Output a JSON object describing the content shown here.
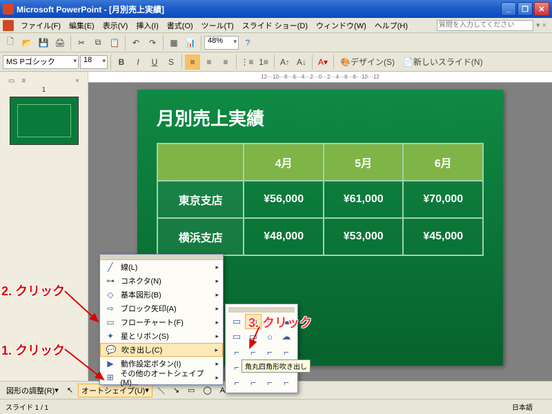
{
  "title": "Microsoft PowerPoint - [月別売上実績]",
  "window_buttons": {
    "min": "_",
    "max": "❐",
    "close": "✕"
  },
  "menu": [
    "ファイル(F)",
    "編集(E)",
    "表示(V)",
    "挿入(I)",
    "書式(O)",
    "ツール(T)",
    "スライド ショー(D)",
    "ウィンドウ(W)",
    "ヘルプ(H)"
  ],
  "question_box": "質問を入力してください",
  "font_name": "MS Pゴシック",
  "font_size": "18",
  "zoom": "48%",
  "design_btn": "デザイン(S)",
  "newslide_btn": "新しいスライド(N)",
  "ruler_text": "12···10···8···6···4···2···0···2···4···6···8···10···12",
  "slide": {
    "title": "月別売上実績",
    "headers": [
      "",
      "4月",
      "5月",
      "6月"
    ],
    "rows": [
      [
        "東京支店",
        "¥56,000",
        "¥61,000",
        "¥70,000"
      ],
      [
        "横浜支店",
        "¥48,000",
        "¥53,000",
        "¥45,000"
      ]
    ]
  },
  "autoshape_menu": [
    {
      "icon": "╱",
      "label": "線(L)"
    },
    {
      "icon": "⊶",
      "label": "コネクタ(N)"
    },
    {
      "icon": "◇",
      "label": "基本図形(B)"
    },
    {
      "icon": "⇨",
      "label": "ブロック矢印(A)"
    },
    {
      "icon": "▭",
      "label": "フローチャート(F)"
    },
    {
      "icon": "✦",
      "label": "星とリボン(S)"
    },
    {
      "icon": "💬",
      "label": "吹き出し(C)",
      "hi": true
    },
    {
      "icon": "▶",
      "label": "動作設定ボタン(I)"
    },
    {
      "icon": "⊞",
      "label": "その他のオートシェイプ(M)..."
    }
  ],
  "palette_icons": [
    [
      "▭",
      "▭",
      "○",
      "☁"
    ],
    [
      "▭",
      "▭",
      "○",
      "☁"
    ],
    [
      "⌐",
      "⌐",
      "⌐",
      "⌐"
    ],
    [
      "⌐",
      "⌐",
      "⌐",
      "⌐"
    ],
    [
      "⌐",
      "⌐",
      "⌐",
      "⌐"
    ]
  ],
  "tooltip": "角丸四角形吹き出し",
  "drawbar": {
    "shape_adj": "図形の調整(R)",
    "autoshape": "オートシェイプ(U)"
  },
  "status": {
    "slide": "スライド 1 / 1",
    "lang": "日本語"
  },
  "annotations": {
    "a1": "1. クリック",
    "a2": "2. クリック",
    "a3": "3. クリック"
  }
}
